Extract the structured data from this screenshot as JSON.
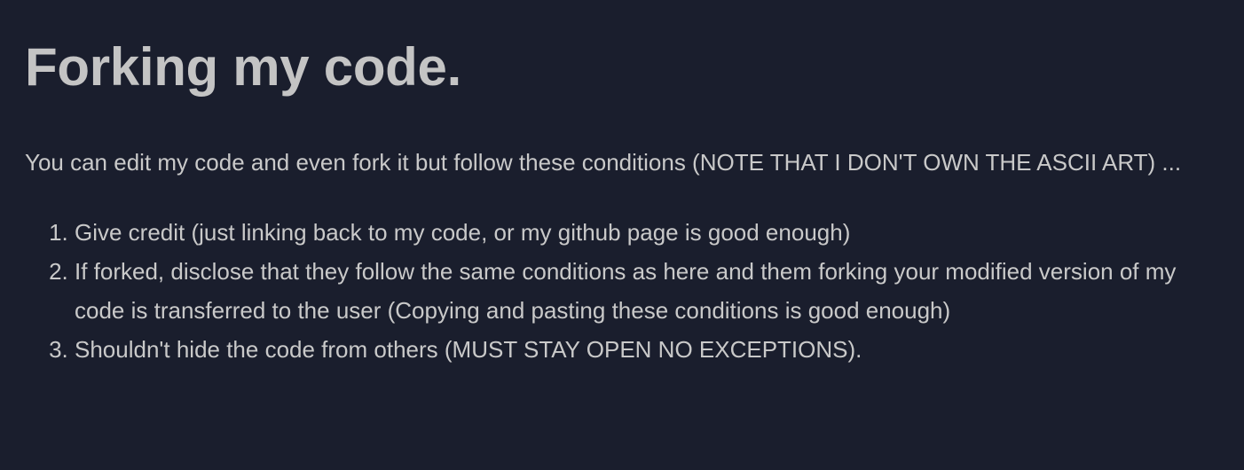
{
  "heading": "Forking my code.",
  "intro": "You can edit my code and even fork it but follow these conditions (NOTE THAT I DON'T OWN THE ASCII ART) ...",
  "conditions": [
    "Give credit (just linking back to my code, or my github page is good enough)",
    "If forked, disclose that they follow the same conditions as here and them forking your modified version of my code is transferred to the user (Copying and pasting these conditions is good enough)",
    "Shouldn't hide the code from others (MUST STAY OPEN NO EXCEPTIONS)."
  ],
  "colors": {
    "background": "#1a1e2d",
    "heading": "#c4c4c4",
    "text": "#c9c9c9"
  }
}
